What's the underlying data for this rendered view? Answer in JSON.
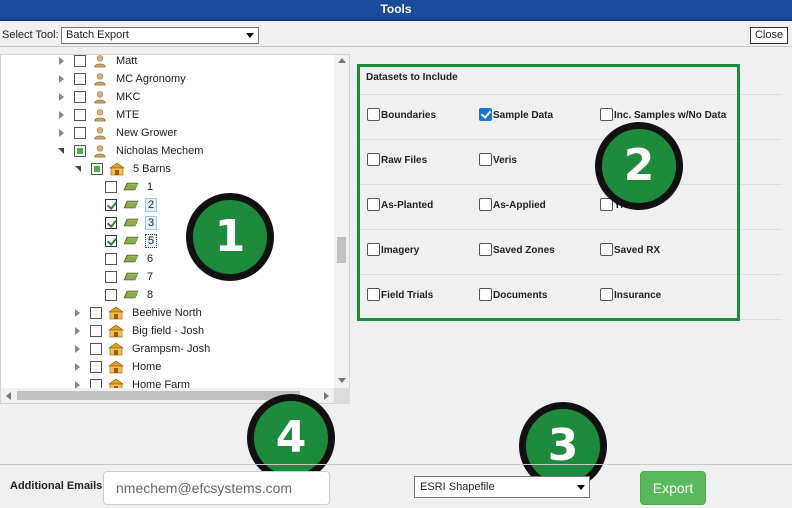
{
  "window": {
    "title": "Tools"
  },
  "toolbar": {
    "select_label": "Select Tool:",
    "tool_value": "Batch Export",
    "close_label": "Close"
  },
  "tree": {
    "growers": [
      "Matt",
      "MC Agronomy",
      "MKC",
      "MTE",
      "New Grower",
      "Nicholas Mechem"
    ],
    "farm": "5 Barns",
    "fields": [
      "1",
      "2",
      "3",
      "5",
      "6",
      "7",
      "8"
    ],
    "farms": [
      "Beehive North",
      "Big field - Josh",
      "Grampsm- Josh",
      "Home",
      "Home Farm"
    ]
  },
  "datasets": {
    "title": "Datasets to Include",
    "options": [
      {
        "label": "Boundaries",
        "checked": false
      },
      {
        "label": "Sample Data",
        "checked": true
      },
      {
        "label": "Inc. Samples w/No Data",
        "checked": false
      },
      {
        "label": "Raw Files",
        "checked": false
      },
      {
        "label": "Veris",
        "checked": false
      },
      {
        "label": "As-Planted",
        "checked": false
      },
      {
        "label": "As-Applied",
        "checked": false
      },
      {
        "label": "Yield",
        "checked": false
      },
      {
        "label": "Imagery",
        "checked": false
      },
      {
        "label": "Saved Zones",
        "checked": false
      },
      {
        "label": "Saved RX",
        "checked": false
      },
      {
        "label": "Field Trials",
        "checked": false
      },
      {
        "label": "Documents",
        "checked": false
      },
      {
        "label": "Insurance",
        "checked": false
      }
    ]
  },
  "callouts": [
    "1",
    "2",
    "3",
    "4"
  ],
  "bottom": {
    "emails_label": "Additional Emails",
    "email_value": "nmechem@efcsystems.com",
    "format_value": "ESRI Shapefile",
    "export_label": "Export"
  },
  "colors": {
    "title_bar": "#1a4a9a",
    "callout_green": "#1e8a3c",
    "export_button": "#5cb85c",
    "checkbox_blue": "#1976d2"
  }
}
